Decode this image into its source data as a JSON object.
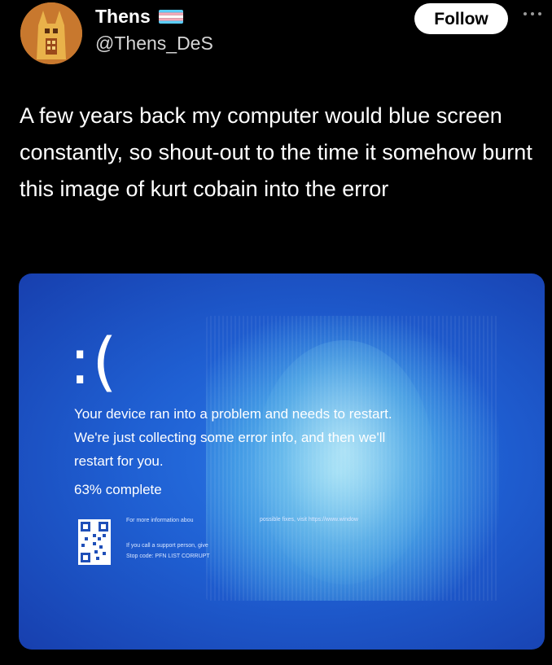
{
  "author": {
    "display_name": "Thens",
    "handle": "@Thens_DeS",
    "avatar_icon": "llama-mask-avatar",
    "flag_icon": "transgender-flag-icon"
  },
  "actions": {
    "follow_label": "Follow",
    "more_icon": "ellipsis-icon"
  },
  "post": {
    "text": "A few years back my computer would blue screen constantly, so shout-out to the time it somehow burnt this image of kurt cobain into the error"
  },
  "bsod": {
    "sad_face": ":(",
    "message_lines": [
      "Your device ran into a problem and needs to restart.",
      "We're just collecting some error info, and then we'll",
      "restart for you."
    ],
    "progress": "63% complete",
    "more_info": "For more information abou",
    "fixes_link": "possible fixes, visit https://www.window",
    "support_line": "If you call a support person, give",
    "stop_code": "Stop code: PFN LIST CORRUPT"
  },
  "colors": {
    "background": "#000000",
    "bsod_blue": "#1f5fd2",
    "follow_bg": "#ffffff",
    "handle_gray": "#d6d6d6"
  }
}
